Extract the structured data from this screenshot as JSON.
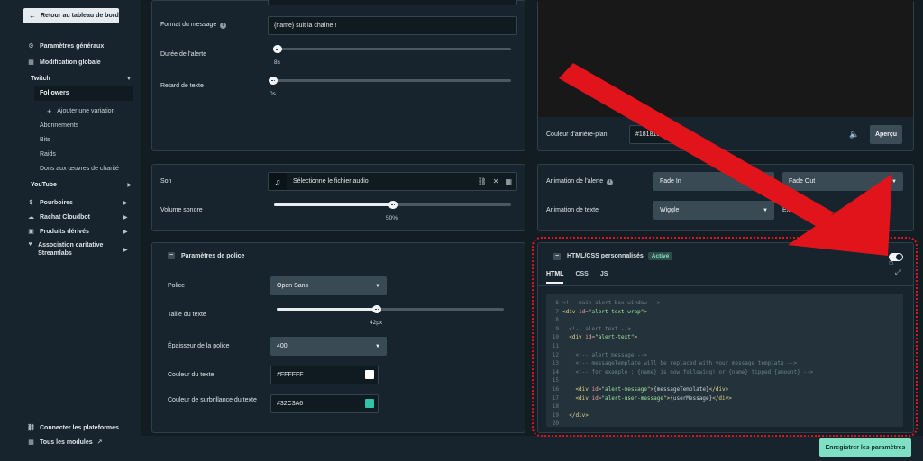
{
  "sidebar": {
    "back_label": "Retour au tableau de bord",
    "items": [
      {
        "label": "Paramètres généraux"
      },
      {
        "label": "Modification globale"
      }
    ],
    "twitch": {
      "label": "Twitch",
      "subitems": [
        {
          "label": "Followers"
        },
        {
          "label": "Ajouter une variation"
        },
        {
          "label": "Abonnements"
        },
        {
          "label": "Bits"
        },
        {
          "label": "Raids"
        },
        {
          "label": "Dons aux œuvres de charité"
        }
      ]
    },
    "youtube": {
      "label": "YouTube"
    },
    "groups": [
      {
        "label": "Pourboires"
      },
      {
        "label": "Rachat Cloudbot"
      },
      {
        "label": "Produits dérivés"
      },
      {
        "label": "Association caritative Streamlabs"
      }
    ],
    "footer": [
      {
        "label": "Connecter les plateformes"
      },
      {
        "label": "Tous les modules"
      }
    ]
  },
  "message": {
    "format_label": "Format du message",
    "format_value": "{name} suit la chaîne !",
    "duration_label": "Durée de l'alerte",
    "duration_value": "8s",
    "duration_level": 0.02,
    "delay_label": "Retard de texte",
    "delay_value": "0s",
    "delay_level": 0.0
  },
  "sound": {
    "label": "Son",
    "file_placeholder": "Sélectionne le fichier audio",
    "volume_label": "Volume sonore",
    "volume_value": "50%",
    "volume_level": 0.5
  },
  "font": {
    "section_title": "Paramètres de police",
    "font_label": "Police",
    "font_value": "Open Sans",
    "size_label": "Taille du texte",
    "size_value": "42px",
    "size_level": 0.44,
    "weight_label": "Épaisseur de la police",
    "weight_value": "400",
    "color_label": "Couleur du texte",
    "color_value": "#FFFFFF",
    "highlight_label": "Couleur de surbrillance du texte",
    "highlight_value": "#32C3A6"
  },
  "preview": {
    "bg_label": "Couleur d'arrière-plan",
    "bg_value": "#181818",
    "apercu_label": "Aperçu"
  },
  "animation": {
    "alert_label": "Animation de l'alerte",
    "alert_in": "Fade In",
    "alert_out": "Fade Out",
    "text_label": "Animation de texte",
    "text_value": "Wiggle",
    "text_extra": "Ex"
  },
  "custom": {
    "title": "HTML/CSS personnalisés",
    "badge": "Activé",
    "tabs": [
      "HTML",
      "CSS",
      "JS"
    ],
    "code": [
      {
        "n": "6",
        "parts": [
          [
            "c-com",
            "<!-- main alert box window -->"
          ]
        ]
      },
      {
        "n": "7",
        "parts": [
          [
            "c-tag",
            "<div "
          ],
          [
            "c-attr",
            "id="
          ],
          [
            "c-str",
            "\"alert-text-wrap\""
          ],
          [
            "c-tag",
            ">"
          ]
        ]
      },
      {
        "n": "8",
        "parts": []
      },
      {
        "n": "9",
        "parts": [
          [
            "c-com",
            "  <!-- alert text -->"
          ]
        ]
      },
      {
        "n": "10",
        "parts": [
          [
            "c-tag",
            "  <div "
          ],
          [
            "c-attr",
            "id="
          ],
          [
            "c-str",
            "\"alert-text\""
          ],
          [
            "c-tag",
            ">"
          ]
        ]
      },
      {
        "n": "11",
        "parts": []
      },
      {
        "n": "12",
        "parts": [
          [
            "c-com",
            "    <!-- alert message -->"
          ]
        ]
      },
      {
        "n": "13",
        "parts": [
          [
            "c-com",
            "    <!-- messageTemplate will be replaced with your message template -->"
          ]
        ]
      },
      {
        "n": "14",
        "parts": [
          [
            "c-com",
            "    <!-- for example : {name} is now following! or {name} tipped {amount} -->"
          ]
        ]
      },
      {
        "n": "15",
        "parts": []
      },
      {
        "n": "16",
        "parts": [
          [
            "c-tag",
            "    <div "
          ],
          [
            "c-attr",
            "id="
          ],
          [
            "c-str",
            "\"alert-message\""
          ],
          [
            "c-tag",
            ">"
          ],
          [
            "c-txt",
            "{messageTemplate}"
          ],
          [
            "c-tag",
            "</div>"
          ]
        ]
      },
      {
        "n": "17",
        "parts": [
          [
            "c-tag",
            "    <div "
          ],
          [
            "c-attr",
            "id="
          ],
          [
            "c-str",
            "\"alert-user-message\""
          ],
          [
            "c-tag",
            ">"
          ],
          [
            "c-txt",
            "{userMessage}"
          ],
          [
            "c-tag",
            "</div>"
          ]
        ]
      },
      {
        "n": "18",
        "parts": []
      },
      {
        "n": "19",
        "parts": [
          [
            "c-tag",
            "  </div>"
          ]
        ]
      },
      {
        "n": "20",
        "parts": []
      }
    ]
  },
  "save_label": "Enregistrer les paramètres",
  "colors": {
    "accent": "#7FE0C3",
    "highlight": "#32C3A6",
    "annotation": "#E0141A"
  }
}
